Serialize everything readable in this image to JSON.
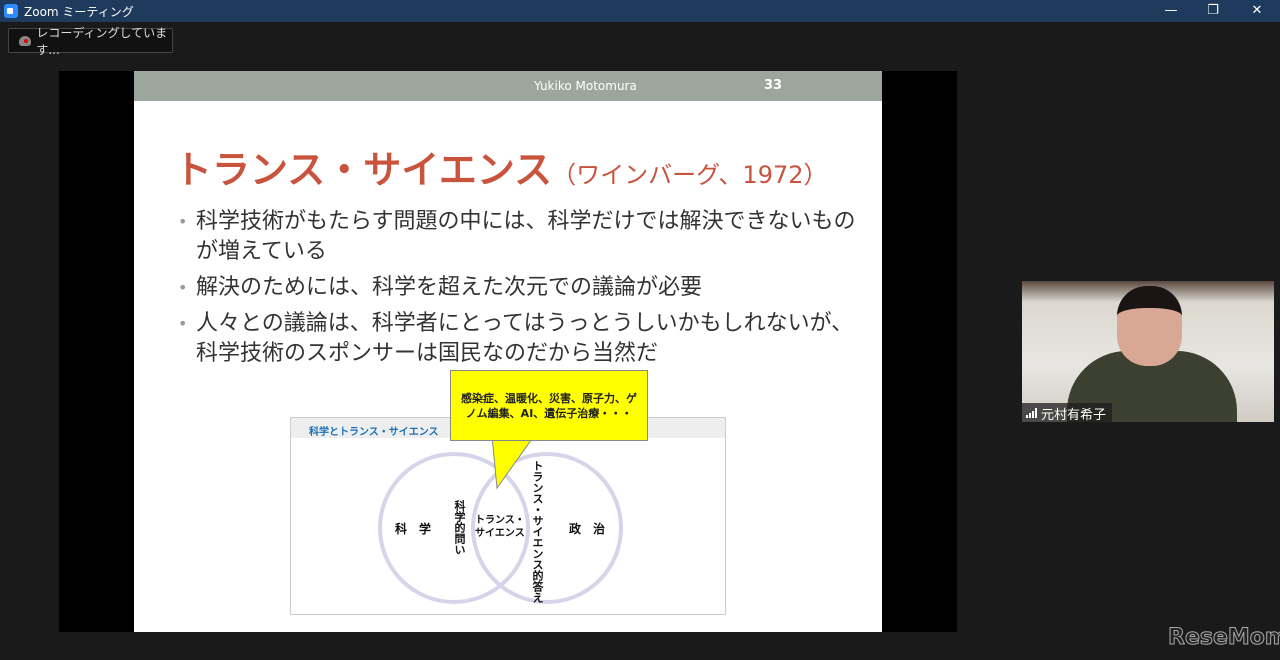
{
  "window": {
    "title": "Zoom ミーティング",
    "minimize": "—",
    "restore": "❐",
    "close": "✕"
  },
  "recording": {
    "label": "レコーディングしています..."
  },
  "slide": {
    "presenter": "Yukiko Motomura",
    "page": "33",
    "title": "トランス・サイエンス",
    "title_sub": "（ワインバーグ、1972）",
    "bullets": [
      "科学技術がもたらす問題の中には、科学だけでは解決できないものが増えている",
      "解決のためには、科学を超えた次元での議論が必要",
      "人々との議論は、科学者にとってはうっとうしいかもしれないが、科学技術のスポンサーは国民なのだから当然だ"
    ],
    "diagram": {
      "title": "科学とトランス・サイエンス",
      "left": "科　学",
      "right": "政　治",
      "left_inner": "科学的問い",
      "center": [
        "トランス・",
        "サイエンス"
      ],
      "right_inner": "トランス・サイエンス的答え"
    },
    "callout": "感染症、温暖化、災害、原子力、ゲノム編集、AI、遺伝子治療・・・"
  },
  "participant": {
    "name": "元村有希子"
  },
  "watermark": "ReseMom"
}
